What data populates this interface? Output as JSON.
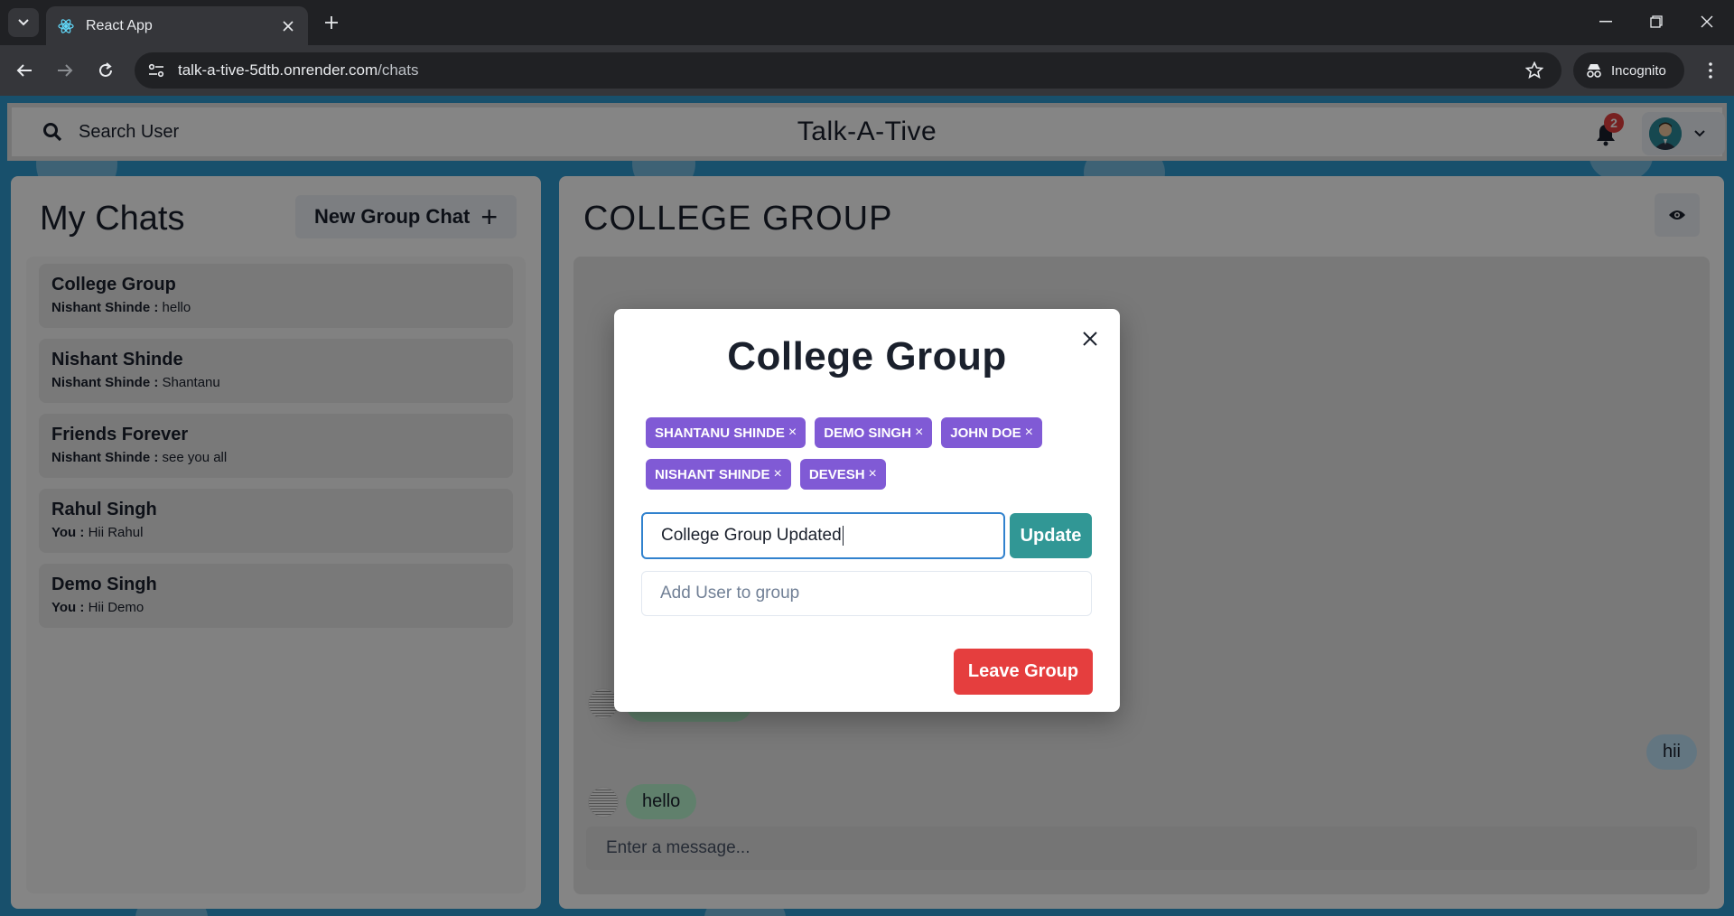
{
  "browser": {
    "tab_title": "React App",
    "url_host": "talk-a-tive-5dtb.onrender.com",
    "url_path": "/chats",
    "incognito_label": "Incognito"
  },
  "header": {
    "search_label": "Search User",
    "app_title": "Talk-A-Tive",
    "notification_count": "2"
  },
  "my_chats": {
    "title": "My Chats",
    "new_group_label": "New Group Chat",
    "chats": [
      {
        "name": "College Group",
        "sender": "Nishant Shinde :",
        "message": "hello"
      },
      {
        "name": "Nishant Shinde",
        "sender": "Nishant Shinde :",
        "message": "Shantanu"
      },
      {
        "name": "Friends Forever",
        "sender": "Nishant Shinde :",
        "message": "see you all"
      },
      {
        "name": "Rahul Singh",
        "sender": "You :",
        "message": "Hii Rahul"
      },
      {
        "name": "Demo Singh",
        "sender": "You :",
        "message": "Hii Demo"
      }
    ]
  },
  "chat": {
    "title": "COLLEGE GROUP",
    "messages": [
      {
        "text": "hii",
        "mine": true
      },
      {
        "text": "hello",
        "mine": false
      }
    ],
    "input_placeholder": "Enter a message..."
  },
  "modal": {
    "title": "College Group",
    "members": [
      "SHANTANU SHINDE",
      "DEMO SINGH",
      "JOHN DOE",
      "NISHANT SHINDE",
      "DEVESH"
    ],
    "rename_value": "College Group Updated",
    "update_label": "Update",
    "add_user_placeholder": "Add User to group",
    "leave_label": "Leave Group"
  },
  "colors": {
    "badge": "#805ad5",
    "update": "#319795",
    "leave": "#e53e3e",
    "page_bg": "#2e9ad0"
  }
}
